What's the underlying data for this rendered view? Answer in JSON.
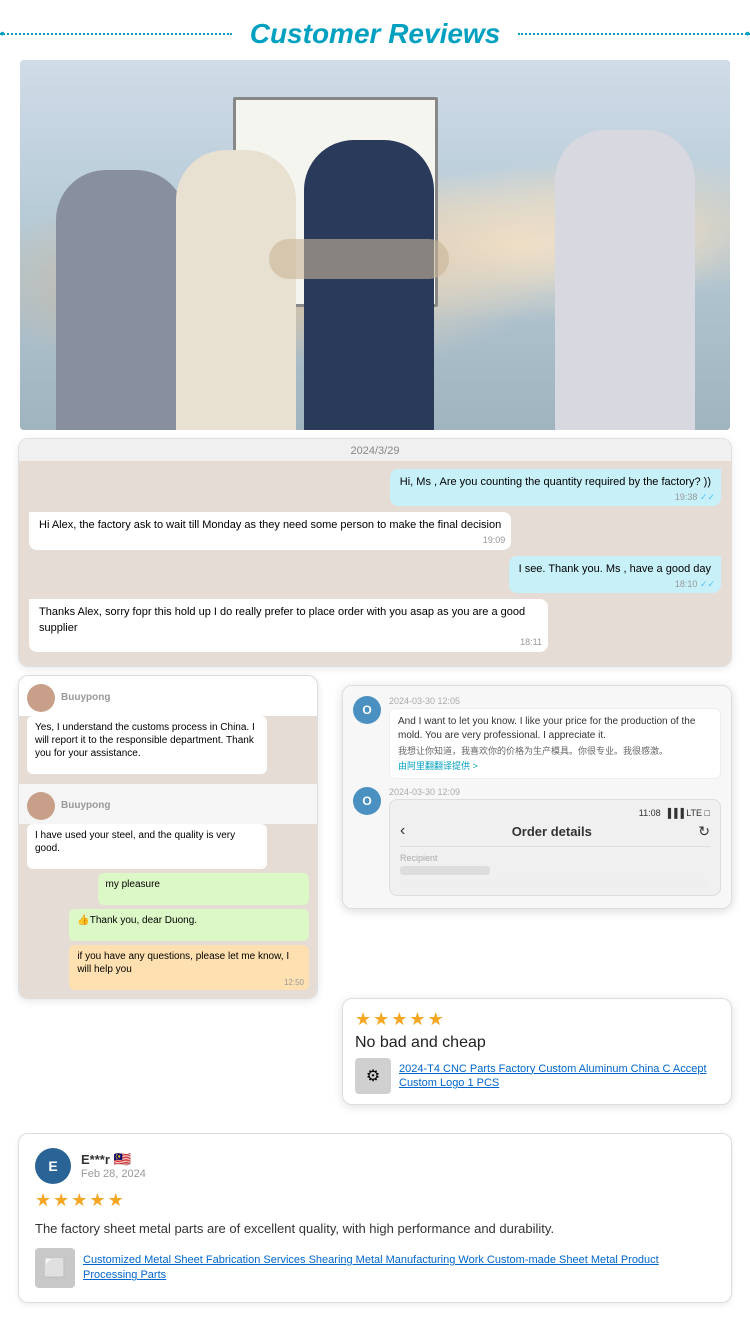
{
  "header": {
    "title": "Customer Reviews",
    "left_dot": "•",
    "right_dot": "•"
  },
  "chat1": {
    "date": "2024/3/29",
    "msg1": {
      "text": "Hi, Ms         , Are you counting the quantity required by the factory? ))",
      "time": "19:38",
      "type": "sent"
    },
    "msg2": {
      "text": "Hi Alex, the factory ask to wait till Monday as they need some person to make the final decision",
      "time": "19:09",
      "type": "received"
    },
    "msg3": {
      "text": "I see. Thank you. Ms         , have a good day",
      "time": "18:10",
      "type": "sent"
    },
    "msg4": {
      "text": "Thanks Alex, sorry fopr this hold up I do really prefer to place order with you asap as you are a good supplier",
      "time": "18:11",
      "type": "received"
    }
  },
  "chat_left": {
    "user1": "Buuypong",
    "msg1": "Yes, I understand the customs process in China. I will report it to the responsible department. Thank you for your assistance.",
    "user2": "Buuypong",
    "msg2": "I have used your steel, and the quality is very good.",
    "reply1": "my pleasure",
    "reply2": "👍Thank you, dear Duong.",
    "reply3": "if you have any questions, please let me know, I will help you",
    "time1": "12:50"
  },
  "chat_right": {
    "date1": "2024-03-30 12:05",
    "msg1_text": "And I want to let you know. I like your price for the production of the mold. You are very professional. I appreciate it.",
    "msg1_sub": "我想让你知道，我喜欢你的价格为生产模具。你很专业。我很感激。",
    "msg1_tag": "由阿里翻翻译提供 >",
    "date2": "2024-03-30 12:09",
    "order_time": "11:08",
    "order_title": "Order details",
    "recipient_label": "Recipient"
  },
  "review_float": {
    "stars": 5,
    "star_char": "★",
    "text": "No bad and cheap",
    "product_text": "2024-T4 CNC Parts Factory Custom Aluminum China C Accept Custom Logo 1 PCS"
  },
  "review_main": {
    "reviewer_initial": "E",
    "reviewer_name": "E***r",
    "reviewer_flag": "🇲🇾",
    "reviewer_date": "Feb 28, 2024",
    "stars": 5,
    "star_char": "★",
    "text": "The factory sheet metal parts are of excellent quality, with high performance and durability.",
    "product_text": "Customized Metal Sheet Fabrication Services Shearing Metal Manufacturing Work Custom-made Sheet Metal Product Processing Parts"
  }
}
